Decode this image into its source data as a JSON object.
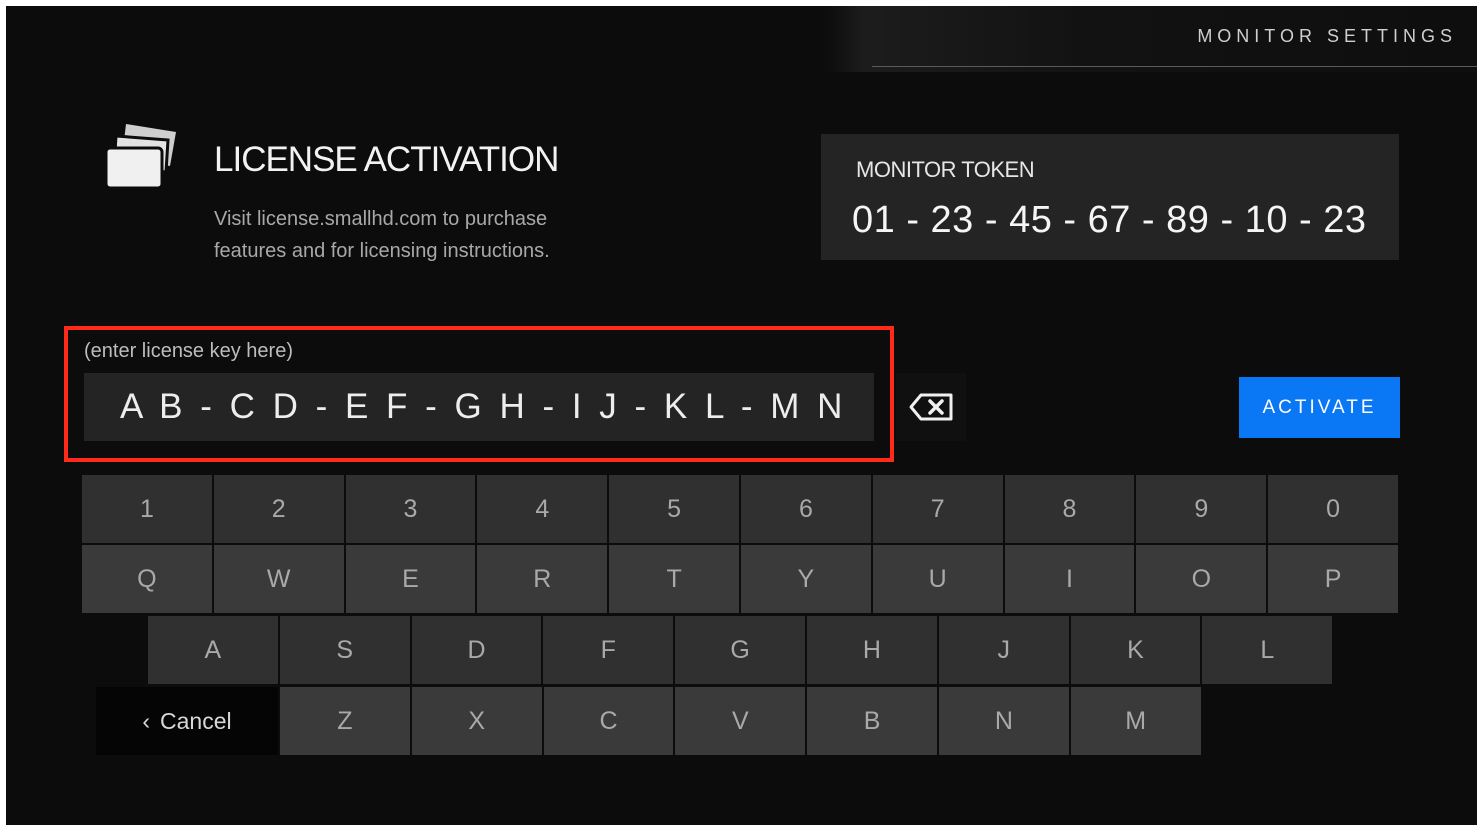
{
  "header": {
    "title": "MONITOR SETTINGS"
  },
  "page": {
    "title": "LICENSE ACTIVATION",
    "subtitle_line1": "Visit license.smallhd.com to purchase",
    "subtitle_line2": "features and for licensing instructions."
  },
  "token": {
    "label": "MONITOR TOKEN",
    "value": "01 - 23 - 45 - 67 - 89 - 10 - 23"
  },
  "license_key": {
    "placeholder": "(enter license key here)",
    "value": "A B - C D - E F - G H - I J - K L - M N"
  },
  "actions": {
    "activate": "ACTIVATE",
    "cancel": "Cancel"
  },
  "icons": {
    "cards": "license-cards-icon",
    "backspace": "backspace-icon",
    "back": "chevron-left-icon"
  },
  "colors": {
    "accent": "#0a78f5",
    "highlight": "#ff2a1a"
  },
  "keyboard": {
    "row1": [
      "1",
      "2",
      "3",
      "4",
      "5",
      "6",
      "7",
      "8",
      "9",
      "0"
    ],
    "row2": [
      "Q",
      "W",
      "E",
      "R",
      "T",
      "Y",
      "U",
      "I",
      "O",
      "P"
    ],
    "row3": [
      "A",
      "S",
      "D",
      "F",
      "G",
      "H",
      "J",
      "K",
      "L"
    ],
    "row4": [
      "Z",
      "X",
      "C",
      "V",
      "B",
      "N",
      "M"
    ]
  }
}
